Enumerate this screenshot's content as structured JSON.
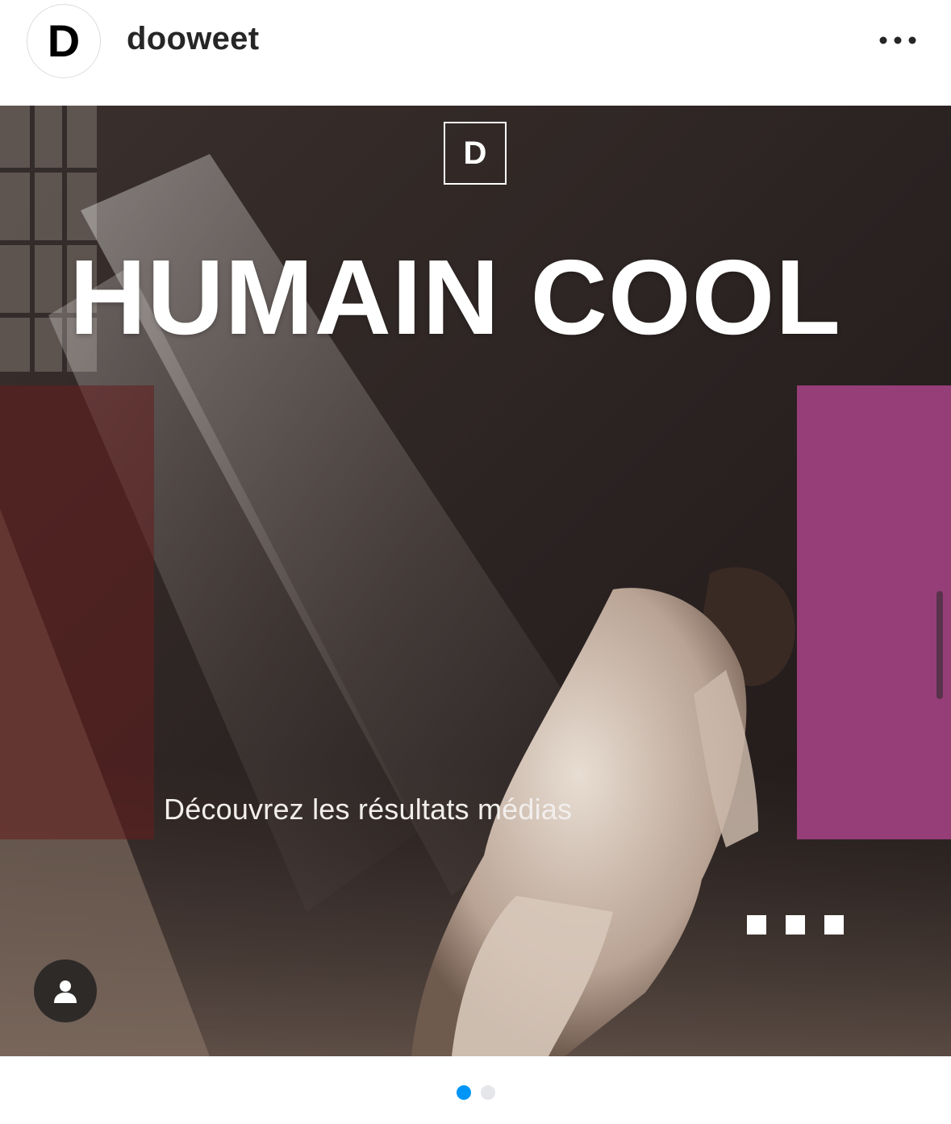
{
  "account": {
    "avatar_letter": "D",
    "username": "dooweet"
  },
  "menu": {
    "icon": "more-horizontal-icon"
  },
  "media": {
    "logo_letter": "D",
    "headline": "HUMAIN COOL",
    "subtitle": "Découvrez les résultats médias",
    "tag_icon": "user-tag-icon",
    "colors": {
      "left_panel": "#641e1e",
      "right_panel": "#963e78",
      "headline": "#ffffff"
    }
  },
  "carousel": {
    "total_slides": 2,
    "active_index": 1,
    "active_color": "#0095f6",
    "inactive_color": "#e4e6ea"
  }
}
